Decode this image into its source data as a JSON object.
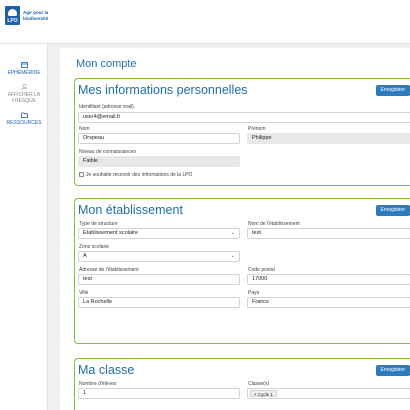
{
  "header": {
    "logo_text": "LPO",
    "tagline": "Agir pour la biodiversité"
  },
  "sidebar": {
    "items": [
      {
        "label": "EPHÉMÉRIDE",
        "icon": "calendar-icon"
      },
      {
        "label": "AFFICHER LA FRESQUE",
        "icon": "fresco-icon"
      },
      {
        "label": "RESSOURCES",
        "icon": "folder-icon"
      }
    ]
  },
  "page": {
    "title": "Mon compte"
  },
  "personal": {
    "title": "Mes informations personnelles",
    "save": "Enregistrer",
    "email_label": "Identifiant (adresse mail)",
    "email_value": "user4@email.fr",
    "nom_label": "Nom",
    "nom_value": "Orspeau",
    "prenom_label": "Prénom",
    "prenom_value": "Philippe",
    "niveau_label": "Niveau de connaissances",
    "niveau_value": "Faible",
    "newsletter_label": "Je souhaite recevoir des informations de la LPO"
  },
  "school": {
    "title": "Mon établissement",
    "save": "Enregistrer",
    "type_label": "Type de structure",
    "type_value": "Etablissement scolaire",
    "name_label": "Nom de l'établissement",
    "name_value": "test",
    "zone_label": "Zone scolaire",
    "zone_value": "A",
    "address_label": "Adresse de l'établissement",
    "address_value": "test",
    "postal_label": "Code postal",
    "postal_value": "17000",
    "city_label": "Ville",
    "city_value": "La Rochelle",
    "country_label": "Pays",
    "country_value": "France"
  },
  "class": {
    "title": "Ma classe",
    "save": "Enregistrer",
    "students_label": "Nombre d'élèves",
    "students_value": "1",
    "classes_label": "Classe(s)",
    "classes_tag": "× Cycle 1"
  },
  "colors": {
    "brand_blue": "#1f5fa8",
    "accent_green": "#7ac143",
    "button_blue": "#2b7bbd"
  }
}
